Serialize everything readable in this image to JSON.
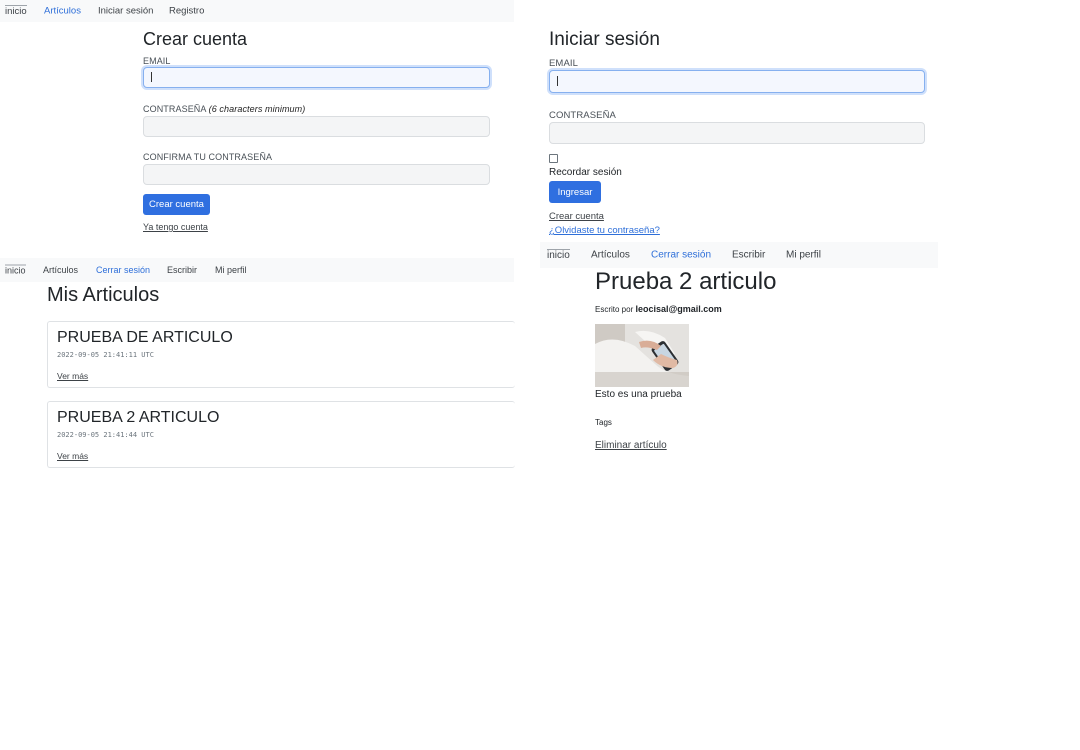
{
  "nav_register": {
    "items": [
      "inicio",
      "Artículos",
      "Iniciar sesión",
      "Registro"
    ],
    "active_index": 1
  },
  "register": {
    "title": "Crear cuenta",
    "email_label": "EMAIL",
    "password_label": "CONTRASEÑA",
    "password_hint": "(6 characters minimum)",
    "confirm_label": "CONFIRMA TU CONTRASEÑA",
    "submit_label": "Crear cuenta",
    "have_account_link": "Ya tengo cuenta"
  },
  "login": {
    "title": "Iniciar sesión",
    "email_label": "EMAIL",
    "password_label": "CONTRASEÑA",
    "remember_label": "Recordar sesión",
    "submit_label": "Ingresar",
    "create_account_link": "Crear cuenta",
    "forgot_link": "¿Olvidaste tu contraseña?"
  },
  "nav_articles": {
    "items": [
      "inicio",
      "Artículos",
      "Cerrar sesión",
      "Escribir",
      "Mi perfil"
    ],
    "active_index": 2
  },
  "my_articles": {
    "title": "Mis Articulos",
    "cards": [
      {
        "title": "PRUEBA DE ARTICULO",
        "timestamp": "2022-09-05 21:41:11 UTC",
        "more": "Ver más"
      },
      {
        "title": "PRUEBA 2 ARTICULO",
        "timestamp": "2022-09-05 21:41:44 UTC",
        "more": "Ver más"
      }
    ]
  },
  "nav_article": {
    "items": [
      "inicio",
      "Artículos",
      "Cerrar sesión",
      "Escribir",
      "Mi perfil"
    ],
    "active_index": 2
  },
  "article": {
    "title": "Prueba 2 articulo",
    "written_by": "Escrito por",
    "author": "leocisal@gmail.com",
    "body": "Esto es una prueba",
    "tags_label": "Tags",
    "delete_link": "Eliminar artículo"
  },
  "colors": {
    "accent": "#2f6fe0",
    "nav_bg": "#f8f9fa",
    "focus_border": "#86b0ef"
  }
}
